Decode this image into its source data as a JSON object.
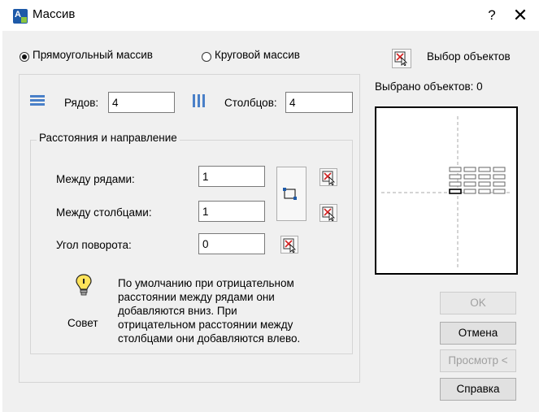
{
  "window": {
    "title": "Массив",
    "help_glyph": "?",
    "close_glyph": "✕"
  },
  "array_type": {
    "options": [
      {
        "label": "Прямоугольный массив",
        "selected": true
      },
      {
        "label": "Круговой массив",
        "selected": false
      }
    ]
  },
  "rows_cols": {
    "rows_label": "Рядов:",
    "rows_value": "4",
    "cols_label": "Столбцов:",
    "cols_value": "4"
  },
  "distance": {
    "legend": "Расстояния и направление",
    "row_offset_label": "Между рядами:",
    "row_offset_value": "1",
    "col_offset_label": "Между столбцами:",
    "col_offset_value": "1",
    "angle_label": "Угол поворота:",
    "angle_value": "0"
  },
  "tip": {
    "label": "Совет",
    "lines": [
      "По умолчанию при отрицательном",
      "расстоянии между рядами они",
      "добавляются вниз. При",
      "отрицательном расстоянии между",
      "столбцами они добавляются влево."
    ]
  },
  "selection": {
    "select_label": "Выбор объектов",
    "count_text": "Выбрано объектов: 0"
  },
  "buttons": {
    "ok": "OK",
    "cancel": "Отмена",
    "preview": "Просмотр <",
    "help": "Справка"
  },
  "colors": {
    "disabled_text": "#a0a0a0",
    "icon_blue": "#1e5aa8",
    "icon_red": "#d22020"
  }
}
